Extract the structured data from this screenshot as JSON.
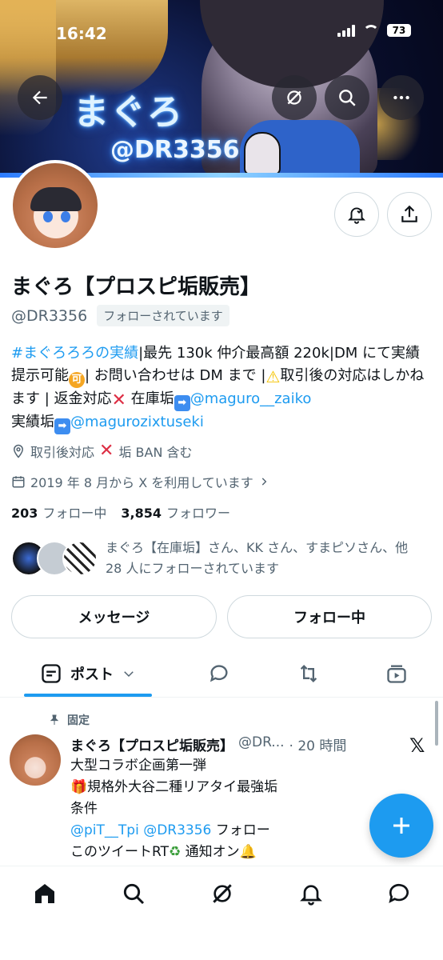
{
  "status_bar": {
    "time": "16:42",
    "battery": "73"
  },
  "banner": {
    "name_art": "まぐろ",
    "handle_art": "@DR3356"
  },
  "profile": {
    "display_name": "まぐろ【プロスピ垢販売】",
    "handle": "@DR3356",
    "follows_you": "フォローされています",
    "bio": {
      "hashtag": "#まぐろろろの実績",
      "text1": "|最先 130k 仲介最高額 220k|DM にて実績提示可能",
      "text2": "| お問い合わせは DM まで |",
      "text3": "取引後の対応はしかねます | 返金対応",
      "text4": " 在庫垢",
      "mention1": "@maguro__zaiko",
      "text5": "実績垢",
      "mention2": "@magurozixtuseki"
    },
    "location": "取引後対応",
    "location_suffix": " 垢 BAN 含む",
    "joined": "2019 年 8 月から X を利用しています",
    "following_count": "203",
    "following_label": "フォロー中",
    "followers_count": "3,854",
    "followers_label": "フォロワー",
    "followed_by": "まぐろ【在庫垢】さん、KK さん、すまピソさん、他 28 人にフォローされています"
  },
  "buttons": {
    "message": "メッセージ",
    "following": "フォロー中"
  },
  "tabs": {
    "posts": "ポスト"
  },
  "pinned_post": {
    "pinned_label": "固定",
    "author_name": "まぐろ【プロスピ垢販売】",
    "author_handle": "@DR...",
    "time": "· 20 時間",
    "line1": "大型コラボ企画第一弾",
    "line2": "規格外大谷二種リアタイ最強垢",
    "line3": "条件",
    "line4_mention": "@piT__Tpi @DR3356",
    "line4_text": " フォロー",
    "line5": "このツイートRT",
    "line5b": " 通知オン"
  },
  "colors": {
    "accent": "#1d9bf0",
    "text": "#0f1419",
    "muted": "#536471"
  }
}
